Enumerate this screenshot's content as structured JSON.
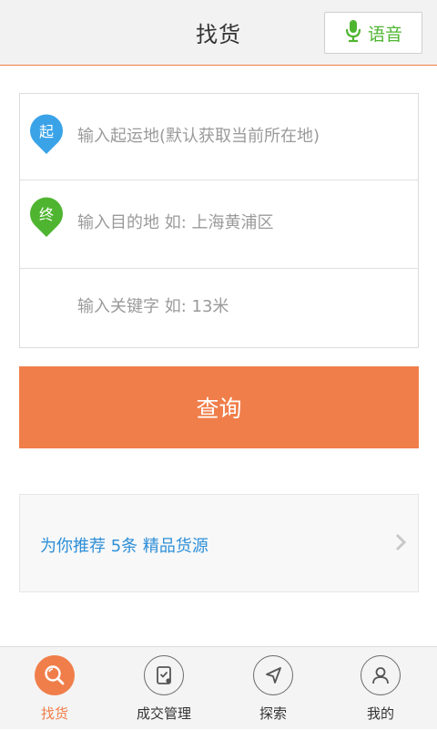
{
  "header": {
    "title": "找货",
    "voice_button": {
      "label": "语音",
      "icon": "microphone-icon"
    }
  },
  "form": {
    "origin": {
      "badge": "起",
      "placeholder": "输入起运地(默认获取当前所在地)",
      "badge_color": "#3aa3e8"
    },
    "destination": {
      "badge": "终",
      "placeholder": "输入目的地   如: 上海黄浦区",
      "badge_color": "#4fb531"
    },
    "keyword": {
      "placeholder": "输入关键字   如: 13米"
    }
  },
  "query_button": {
    "label": "查询"
  },
  "recommend": {
    "text": "为你推荐  5条  精品货源",
    "icon": "chevron-right-icon"
  },
  "tabs": [
    {
      "label": "找货",
      "icon": "search-icon",
      "active": true
    },
    {
      "label": "成交管理",
      "icon": "clipboard-check-icon",
      "active": false
    },
    {
      "label": "探索",
      "icon": "navigation-arrow-icon",
      "active": false
    },
    {
      "label": "我的",
      "icon": "user-icon",
      "active": false
    }
  ],
  "colors": {
    "accent": "#f07e4a",
    "voice_green": "#4fb531",
    "link_blue": "#2e8fd8"
  }
}
